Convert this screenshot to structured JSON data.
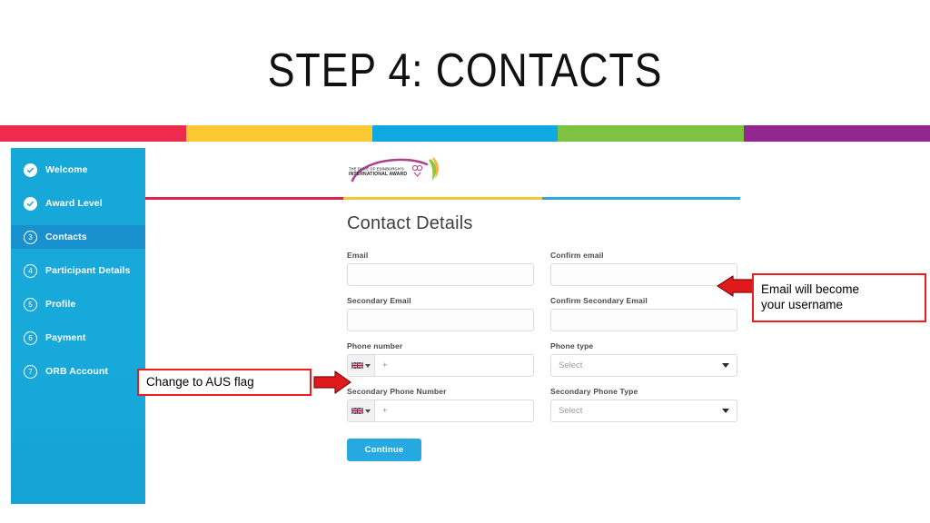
{
  "slide": {
    "title": "STEP 4: CONTACTS"
  },
  "band": {
    "colors": [
      "#ee2b4c",
      "#fbc932",
      "#0fa8e0",
      "#7ec242",
      "#922790"
    ]
  },
  "rule": {
    "colors": [
      "#e0224e",
      "#f3c53f",
      "#2ba9dd"
    ]
  },
  "logo": {
    "name": "duke-of-edinburgh-international-award-logo",
    "line1": "THE DUKE OF EDINBURGH'S",
    "line2": "INTERNATIONAL AWARD"
  },
  "sidebar": {
    "bg": "#17a8da",
    "active_bg": "#1a91cf",
    "items": [
      {
        "label": "Welcome",
        "state": "done",
        "marker": "check",
        "active": false
      },
      {
        "label": "Award Level",
        "state": "done",
        "marker": "check",
        "active": false
      },
      {
        "label": "Contacts",
        "state": "current",
        "marker": "3",
        "active": true
      },
      {
        "label": "Participant Details",
        "state": "todo",
        "marker": "4",
        "active": false
      },
      {
        "label": "Profile",
        "state": "todo",
        "marker": "5",
        "active": false
      },
      {
        "label": "Payment",
        "state": "todo",
        "marker": "6",
        "active": false
      },
      {
        "label": "ORB Account",
        "state": "todo",
        "marker": "7",
        "active": false
      }
    ]
  },
  "form": {
    "title": "Contact Details",
    "fields": {
      "email": {
        "label": "Email",
        "value": ""
      },
      "confirm_email": {
        "label": "Confirm email",
        "value": ""
      },
      "secondary_email": {
        "label": "Secondary Email",
        "value": ""
      },
      "confirm_secondary_email": {
        "label": "Confirm Secondary Email",
        "value": ""
      },
      "phone_number": {
        "label": "Phone number",
        "value": "+",
        "flag": "united-kingdom-flag"
      },
      "phone_type": {
        "label": "Phone type",
        "value": "Select"
      },
      "secondary_phone_number": {
        "label": "Secondary Phone Number",
        "value": "+",
        "flag": "united-kingdom-flag"
      },
      "secondary_phone_type": {
        "label": "Secondary Phone Type",
        "value": "Select"
      }
    },
    "continue_label": "Continue",
    "continue_color": "#26a9e0"
  },
  "annotations": {
    "color": "#ef1c1c",
    "email_note": "Email will become\nyour username",
    "email_note_line1": "Email will become",
    "email_note_line2": "your username",
    "flag_note": "Change to AUS flag"
  }
}
